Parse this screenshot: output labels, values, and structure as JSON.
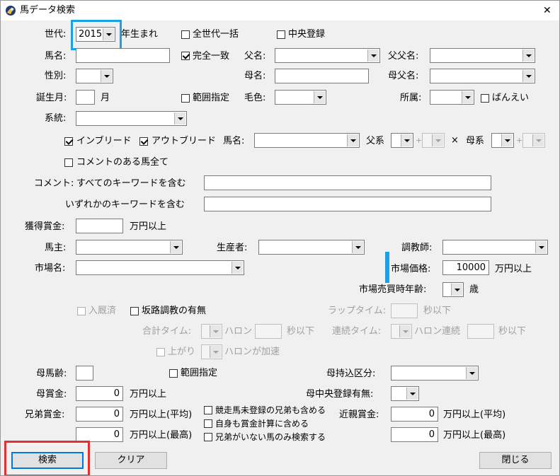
{
  "window": {
    "title": "馬データ検索",
    "close_glyph": "✕"
  },
  "form": {
    "generation_label": "世代:",
    "generation_value": "2015",
    "born_suffix": "年生まれ",
    "all_generations": "全世代一括",
    "central_registered": "中央登録",
    "horse_name_label": "馬名:",
    "exact_match": "完全一致",
    "sire_label": "父名:",
    "sires_sire_label": "父父名:",
    "sex_label": "性別:",
    "dam_label": "母名:",
    "dams_sire_label": "母父名:",
    "birth_month_label": "誕生月:",
    "month_unit": "月",
    "range_spec": "範囲指定",
    "coat_label": "毛色:",
    "affiliation_label": "所属:",
    "banei": "ばんえい",
    "lineage_label": "系統:",
    "inbreed": "インブリード",
    "outbreed": "アウトブリード",
    "breed_horse_label": "馬名:",
    "sire_line_label": "父系",
    "cross": "×",
    "dam_line_label": "母系",
    "plus": "+",
    "with_comment": "コメントのある馬全て",
    "comment_label": "コメント:",
    "comment_all": "すべてのキーワードを含む",
    "comment_any": "いずれかのキーワードを含む",
    "prize_label": "獲得賞金:",
    "man_yen_above": "万円以上",
    "owner_label": "馬主:",
    "breeder_label": "生産者:",
    "trainer_label": "調教師:",
    "market_label": "市場名:",
    "market_price_label": "市場価格:",
    "market_price_value": "10000",
    "market_age_label": "市場売買時年齢:",
    "age_unit": "歳",
    "in_stable": "入厩済",
    "slope_training": "坂路調教の有無",
    "lap_time_label": "ラップタイム:",
    "sec_or_less": "秒以下",
    "total_time_label": "合計タイム:",
    "furlong": "ハロン",
    "consec_time_label": "連続タイム:",
    "furlong_consec": "ハロン連続",
    "agari": "上がり",
    "furlong_accel": "ハロンが加速",
    "dam_age_label": "母馬齢:",
    "dam_import_label": "母持込区分:",
    "dam_prize_label": "母賞金:",
    "dam_prize_value": "0",
    "dam_central_label": "母中央登録有無:",
    "sibling_prize_label": "兄弟賞金:",
    "sibling_avg_value": "0",
    "sibling_max_value": "0",
    "man_yen_avg": "万円以上(平均)",
    "man_yen_max": "万円以上(最高)",
    "include_unraced": "競走馬未登録の兄弟も含める",
    "include_self": "自身も賞金計算に含める",
    "only_no_sibling": "兄弟がいない馬のみ検索する",
    "relative_prize_label": "近親賞金:",
    "relative_avg_value": "0",
    "relative_max_value": "0"
  },
  "buttons": {
    "search": "検索",
    "clear": "クリア",
    "close": "閉じる"
  },
  "colors": {
    "highlight_blue": "#1ea0e6",
    "highlight_red": "#e53030"
  }
}
